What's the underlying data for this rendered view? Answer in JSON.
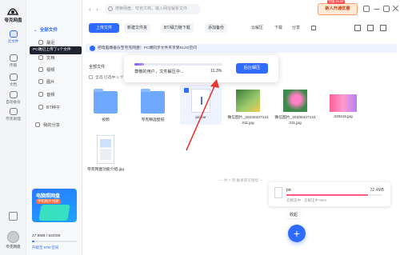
{
  "app": {
    "name": "夸克网盘"
  },
  "rail": {
    "items": [
      {
        "label": "云文件",
        "icon": "cloud-file-icon",
        "active": true
      },
      {
        "label": "传输",
        "icon": "transfer-icon",
        "active": false
      },
      {
        "label": "文档",
        "icon": "document-icon",
        "active": false
      },
      {
        "label": "自动备份",
        "icon": "backup-icon",
        "active": false
      },
      {
        "label": "夸克助理",
        "icon": "assistant-icon",
        "active": false
      }
    ],
    "user_name": "夸克网盘"
  },
  "sidebar": {
    "header": "全部文件",
    "tooltip": "PC端已上传了1个文件",
    "items": [
      "最近",
      "文档",
      "视频",
      "图片",
      "音频",
      "BT种子",
      "我的分享"
    ],
    "promo_title": "电脑照网盘",
    "promo_sub": "手机照片同步",
    "storage": "27.9MB / 522GB",
    "storage_fraction": 0.06,
    "upgrade": "升级至 6TB 空间"
  },
  "topbar": {
    "search_placeholder": "搜索网盘、夸克文档，输入网址解析文件",
    "vip_button": "新人开通优惠",
    "vip_badge": "特惠 ¥9.88"
  },
  "toolbar": {
    "upload": "上传文件",
    "new_folder": "新建文件夹",
    "bt_download": "BT/磁力链下载",
    "add_backup": "添加备份",
    "right_items": [
      "云解压",
      "下载",
      "分享"
    ]
  },
  "notice": "把电脑端备份至夸克网盘！PC端同步文件夹享受512G空间",
  "breadcrumb": "全部文件",
  "select_row": "全选  已选中 1 个",
  "files": [
    {
      "name": "视频",
      "type": "folder"
    },
    {
      "name": "夸克精选壁纸",
      "type": "folder"
    },
    {
      "name": "pic.rar",
      "type": "rar",
      "selected": true
    },
    {
      "name": "微信图片_20230427141311.jpg",
      "type": "image-green"
    },
    {
      "name": "微信图片_20230427141311.jpg",
      "type": "image-pink"
    },
    {
      "name": "326115.jpg",
      "type": "image-gradient"
    },
    {
      "name": "夸克网盘功能介绍.jpg",
      "type": "doc"
    }
  ],
  "footer_text": "— 共 7 项  触发即可继续 —",
  "popup": {
    "text": "尊敬的用户，文件解压中...",
    "percent": "11.3%",
    "progress": 0.113,
    "button": "后台解压"
  },
  "transfer": {
    "name": "pic",
    "size": "22.4MB",
    "status": "云解压中 · 云解压中 85%",
    "progress": 0.85
  },
  "collapse_label": "收起",
  "fab_label": "+",
  "colors": {
    "accent": "#2f6bff",
    "annotation": "#e53935"
  }
}
